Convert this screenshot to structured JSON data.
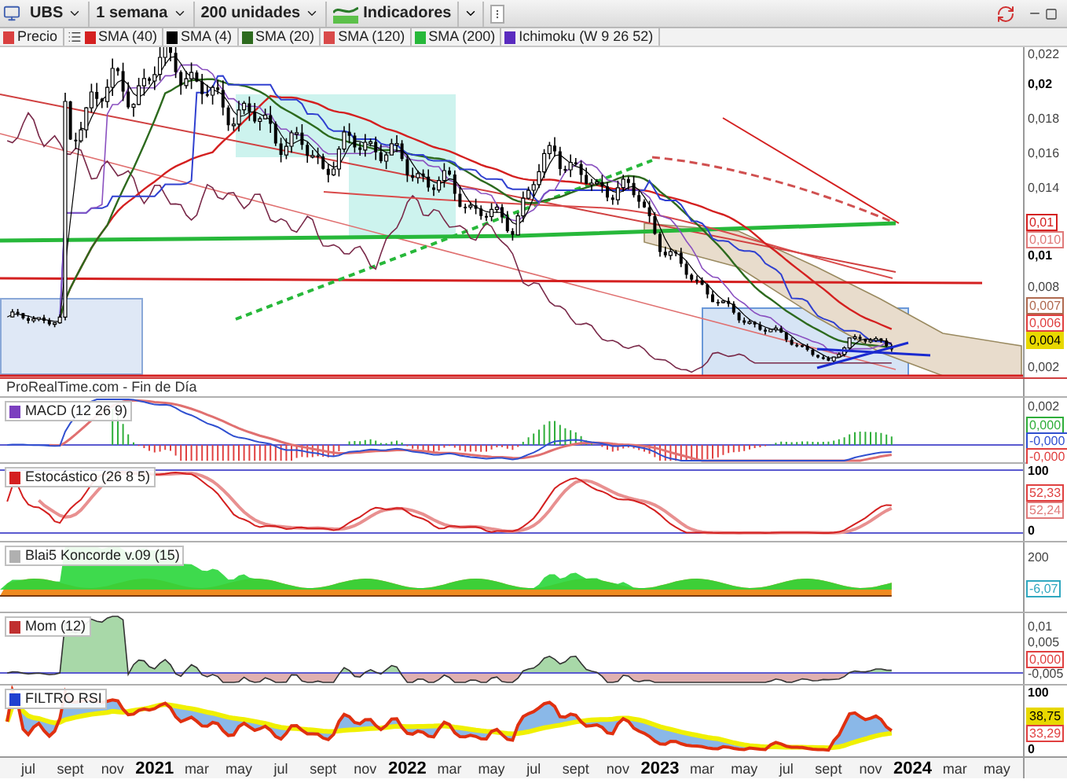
{
  "toolbar": {
    "symbol": "UBS",
    "period": "1 semana",
    "units": "200 unidades",
    "indicators": "Indicadores"
  },
  "legend": [
    {
      "label": "Precio",
      "color": "#d94040"
    },
    {
      "label": "SMA (40)",
      "color": "#d42020"
    },
    {
      "label": "SMA (4)",
      "color": "#000000"
    },
    {
      "label": "SMA (20)",
      "color": "#2d6a1e"
    },
    {
      "label": "SMA (120)",
      "color": "#d94a4a"
    },
    {
      "label": "SMA (200)",
      "color": "#27b83a"
    },
    {
      "label": "Ichimoku (W 9 26 52)",
      "color": "#5a2bbf"
    }
  ],
  "main_axis": [
    {
      "text": "0,022",
      "kind": "tick"
    },
    {
      "text": "0,02",
      "kind": "major"
    },
    {
      "text": "0,018",
      "kind": "tick"
    },
    {
      "text": "0,016",
      "kind": "tick"
    },
    {
      "text": "0,014",
      "kind": "tick"
    },
    {
      "text": "0,01",
      "kind": "tag",
      "color": "#d42020"
    },
    {
      "text": "0,010",
      "kind": "tag",
      "color": "#e07a7a"
    },
    {
      "text": "0,01",
      "kind": "major"
    },
    {
      "text": "0,008",
      "kind": "tick"
    },
    {
      "text": "0,007",
      "kind": "tag",
      "color": "#b06a50"
    },
    {
      "text": "0,006",
      "kind": "tag",
      "color": "#e04040"
    },
    {
      "text": "0,004",
      "kind": "tag",
      "color": "#e8d800"
    },
    {
      "text": "0,002",
      "kind": "tick"
    }
  ],
  "source": "ProRealTime.com - Fin de Día",
  "panels": [
    {
      "kind": "macd",
      "title": "MACD (12 26 9)",
      "color": "#7b3fbf",
      "axis": [
        {
          "text": "0,002",
          "kind": "tick"
        },
        {
          "text": "0,000",
          "kind": "tag",
          "color": "#2fae3a"
        },
        {
          "text": "-0,000",
          "kind": "tag",
          "color": "#3050d0"
        },
        {
          "text": "-0,000",
          "kind": "tag",
          "color": "#e04040"
        }
      ]
    },
    {
      "kind": "stochastic",
      "title": "Estocástico (26 8 5)",
      "color": "#d42020",
      "axis": [
        {
          "text": "100",
          "kind": "major"
        },
        {
          "text": "52,33",
          "kind": "tag",
          "color": "#e04040"
        },
        {
          "text": "52,24",
          "kind": "tag",
          "color": "#e07a7a"
        },
        {
          "text": "0",
          "kind": "major"
        }
      ]
    },
    {
      "kind": "koncorde",
      "title": "Blai5 Koncorde v.09 (15)",
      "color": "#b0b0b0",
      "axis": [
        {
          "text": "200",
          "kind": "tick"
        },
        {
          "text": "-6,07",
          "kind": "tag",
          "color": "#30a8c0"
        }
      ]
    },
    {
      "kind": "momentum",
      "title": "Mom (12)",
      "color": "#c03030",
      "axis": [
        {
          "text": "0,01",
          "kind": "tick"
        },
        {
          "text": "0,005",
          "kind": "tick"
        },
        {
          "text": "0,000",
          "kind": "tag",
          "color": "#e04040"
        },
        {
          "text": "-0,005",
          "kind": "tick"
        }
      ]
    },
    {
      "kind": "rsi",
      "title": "FILTRO RSI",
      "color": "#2040d0",
      "axis": [
        {
          "text": "100",
          "kind": "major"
        },
        {
          "text": "38,75",
          "kind": "tag",
          "color": "#e8d800"
        },
        {
          "text": "33,29",
          "kind": "tag",
          "color": "#e04040"
        },
        {
          "text": "0",
          "kind": "major"
        }
      ]
    }
  ],
  "x_axis": [
    {
      "text": "jul",
      "kind": "month"
    },
    {
      "text": "sept",
      "kind": "month"
    },
    {
      "text": "nov",
      "kind": "month"
    },
    {
      "text": "2021",
      "kind": "year"
    },
    {
      "text": "mar",
      "kind": "month"
    },
    {
      "text": "may",
      "kind": "month"
    },
    {
      "text": "jul",
      "kind": "month"
    },
    {
      "text": "sept",
      "kind": "month"
    },
    {
      "text": "nov",
      "kind": "month"
    },
    {
      "text": "2022",
      "kind": "year"
    },
    {
      "text": "mar",
      "kind": "month"
    },
    {
      "text": "may",
      "kind": "month"
    },
    {
      "text": "jul",
      "kind": "month"
    },
    {
      "text": "sept",
      "kind": "month"
    },
    {
      "text": "nov",
      "kind": "month"
    },
    {
      "text": "2023",
      "kind": "year"
    },
    {
      "text": "mar",
      "kind": "month"
    },
    {
      "text": "may",
      "kind": "month"
    },
    {
      "text": "jul",
      "kind": "month"
    },
    {
      "text": "sept",
      "kind": "month"
    },
    {
      "text": "nov",
      "kind": "month"
    },
    {
      "text": "2024",
      "kind": "year"
    },
    {
      "text": "mar",
      "kind": "month"
    },
    {
      "text": "may",
      "kind": "month"
    }
  ]
}
